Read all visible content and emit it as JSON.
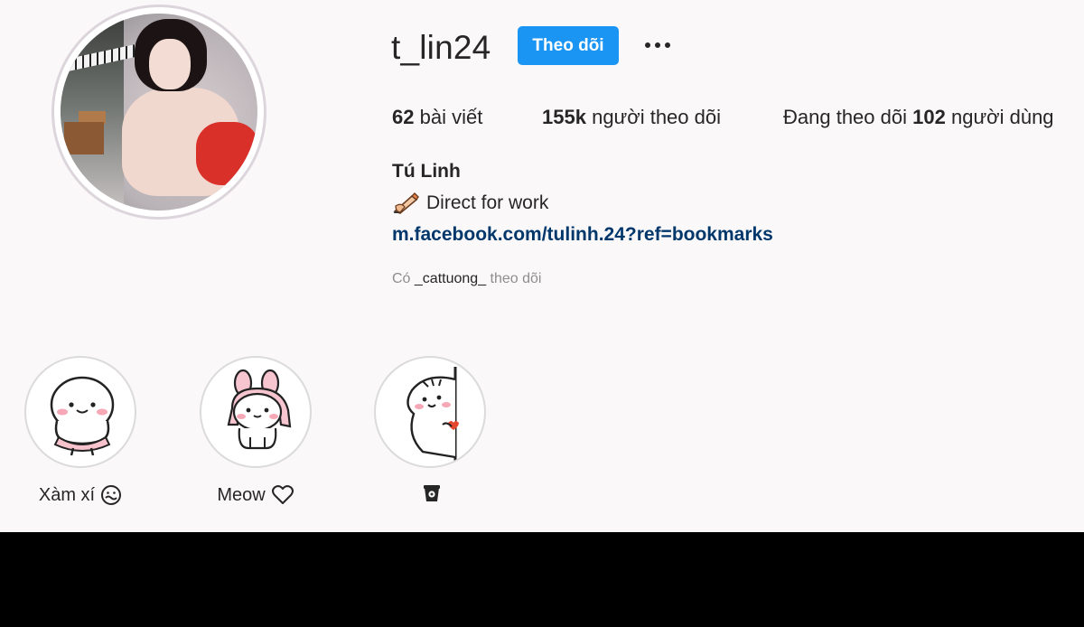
{
  "profile": {
    "username": "t_lin24",
    "follow_label": "Theo dõi",
    "more_label": "•••",
    "stats": {
      "posts_count": "62",
      "posts_label": "bài viết",
      "followers_count": "155k",
      "followers_label": "người theo dõi",
      "following_prefix": "Đang theo dõi",
      "following_count": "102",
      "following_suffix": "người dùng"
    },
    "full_name": "Tú Linh",
    "bio": "Direct for work",
    "bio_icon": "writing-hand-icon",
    "link": "m.facebook.com/tulinh.24?ref=bookmarks",
    "followed_by_prefix": "Có",
    "followed_by_user": "_cattuong_",
    "followed_by_suffix": "theo dõi"
  },
  "highlights": [
    {
      "label": "Xàm xí",
      "icon": "hushed-face-icon"
    },
    {
      "label": "Meow",
      "icon": "heart-outline-icon"
    },
    {
      "label": "",
      "icon": "coffee-cup-icon"
    }
  ],
  "colors": {
    "background": "#fbf8fa",
    "follow_button": "#1b95f3",
    "link": "#00376b",
    "muted": "#8e8e8e"
  }
}
